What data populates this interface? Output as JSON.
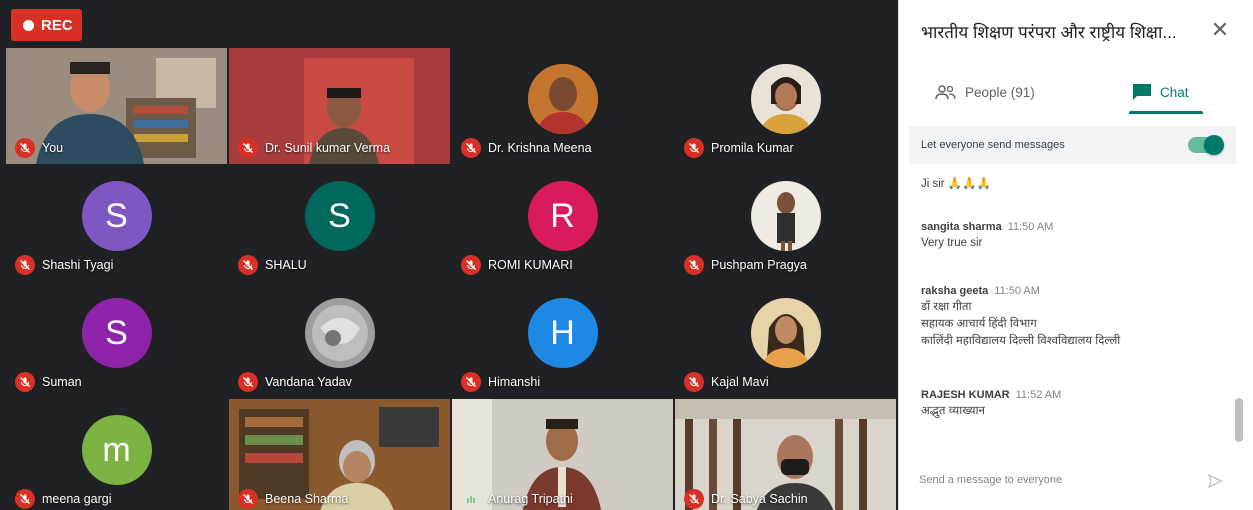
{
  "recording": {
    "label": "REC"
  },
  "participants": [
    {
      "name": "You"
    },
    {
      "name": "Dr. Sunil kumar Verma"
    },
    {
      "name": "Dr. Krishna Meena"
    },
    {
      "name": "Promila Kumar"
    },
    {
      "name": "Shashi Tyagi",
      "initial": "S",
      "color": "#7e57c2"
    },
    {
      "name": "SHALU",
      "initial": "S",
      "color": "#00695c"
    },
    {
      "name": "ROMI KUMARI",
      "initial": "R",
      "color": "#d81b60"
    },
    {
      "name": "Pushpam Pragya"
    },
    {
      "name": "Suman",
      "initial": "S",
      "color": "#8e24aa"
    },
    {
      "name": "Vandana Yadav"
    },
    {
      "name": "Himanshi",
      "initial": "H",
      "color": "#1e88e5"
    },
    {
      "name": "Kajal Mavi"
    },
    {
      "name": "meena gargi",
      "initial": "m",
      "color": "#7cb342"
    },
    {
      "name": "Beena Sharma"
    },
    {
      "name": "Anurag Tripathi"
    },
    {
      "name": "Dr. Sabya Sachin"
    }
  ],
  "panel": {
    "title": "भारतीय शिक्षण परंपरा और राष्ट्रीय शिक्षा...",
    "tabs": {
      "people": "People (91)",
      "chat": "Chat"
    },
    "allow_label": "Let everyone send messages",
    "compose_placeholder": "Send a message to everyone"
  },
  "chat": {
    "first_line": "Ji sir 🙏🙏🙏",
    "messages": [
      {
        "sender": "sangita sharma",
        "time": "11:50 AM",
        "lines": [
          "Very true sir"
        ]
      },
      {
        "sender": "raksha geeta",
        "time": "11:50 AM",
        "lines": [
          "डॉ रक्षा गीता",
          "सहायक आचार्य हिंदी विभाग",
          "कालिंदी महाविद्यालय दिल्ली विश्वविद्यालय दिल्ली"
        ]
      },
      {
        "sender": "RAJESH KUMAR",
        "time": "11:52 AM",
        "lines": [
          "अद्भुत व्याख्यान"
        ]
      }
    ]
  },
  "colors": {
    "accent": "#00796b",
    "rec": "#d93025",
    "background": "#202124"
  }
}
